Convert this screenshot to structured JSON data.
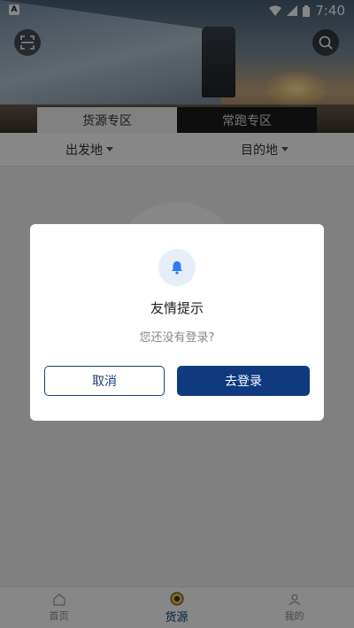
{
  "status_bar": {
    "time": "7:40",
    "left_icon": "A"
  },
  "header": {
    "scan_icon": "scan-icon",
    "search_icon": "search-icon"
  },
  "tabs": [
    {
      "label": "货源专区",
      "active": true
    },
    {
      "label": "常跑专区",
      "active": false
    }
  ],
  "filters": {
    "origin": "出发地",
    "destination": "目的地"
  },
  "dialog": {
    "title": "友情提示",
    "message": "您还没有登录?",
    "cancel_label": "取消",
    "confirm_label": "去登录"
  },
  "bottom_nav": [
    {
      "label": "首页",
      "icon": "home-icon",
      "active": false
    },
    {
      "label": "货源",
      "icon": "goods-icon",
      "active": true
    },
    {
      "label": "我的",
      "icon": "profile-icon",
      "active": false
    }
  ],
  "colors": {
    "primary": "#0f3a80",
    "overlay": "rgba(0,0,0,0.47)",
    "bell_bg": "#e6eef9",
    "bell": "#2d7cf6"
  }
}
